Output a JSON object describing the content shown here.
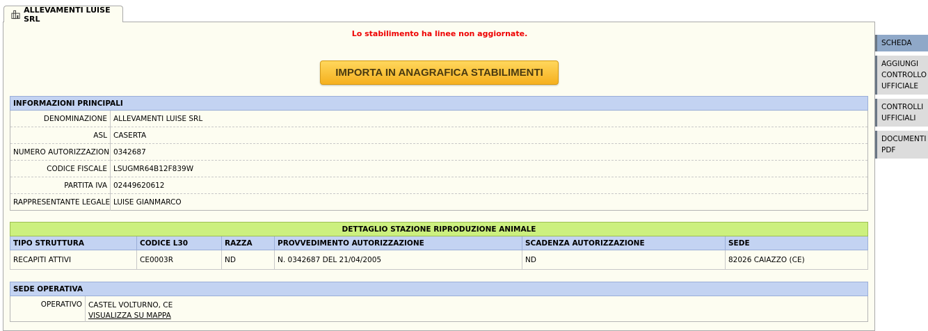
{
  "tab": {
    "title": "ALLEVAMENTI LUISE SRL"
  },
  "alert": "Lo stabilimento ha linee non aggiornate.",
  "import_button": "IMPORTA IN ANAGRAFICA STABILIMENTI",
  "info": {
    "header": "INFORMAZIONI PRINCIPALI",
    "rows": [
      {
        "label": "DENOMINAZIONE",
        "value": "ALLEVAMENTI LUISE SRL"
      },
      {
        "label": "ASL",
        "value": "CASERTA"
      },
      {
        "label": "NUMERO AUTORIZZAZIONE",
        "value": "0342687"
      },
      {
        "label": "CODICE FISCALE",
        "value": "LSUGMR64B12F839W"
      },
      {
        "label": "PARTITA IVA",
        "value": "02449620612"
      },
      {
        "label": "RAPPRESENTANTE LEGALE",
        "value": "LUISE GIANMARCO"
      }
    ]
  },
  "detail": {
    "header": "DETTAGLIO STAZIONE RIPRODUZIONE ANIMALE",
    "columns": [
      "TIPO STRUTTURA",
      "CODICE L30",
      "RAZZA",
      "PROVVEDIMENTO AUTORIZZAZIONE",
      "SCADENZA AUTORIZZAZIONE",
      "SEDE"
    ],
    "row": [
      "RECAPITI ATTIVI",
      "CE0003R",
      "ND",
      "N. 0342687 DEL 21/04/2005",
      "ND",
      "82026 CAIAZZO (CE)"
    ]
  },
  "sede": {
    "header": "SEDE OPERATIVA",
    "label": "OPERATIVO",
    "address": "CASTEL VOLTURNO, CE",
    "map_link": "VISUALIZZA SU MAPPA"
  },
  "sidebar": {
    "items": [
      {
        "label": "SCHEDA",
        "active": true
      },
      {
        "label": "AGGIUNGI CONTROLLO UFFICIALE",
        "active": false
      },
      {
        "label": "CONTROLLI UFFICIALI",
        "active": false
      },
      {
        "label": "DOCUMENTI PDF",
        "active": false
      }
    ]
  },
  "colors": {
    "header_blue": "#c3d3f2",
    "header_green": "#ccf07f",
    "alert_red": "#ee0000",
    "button_orange": "#f5b01e",
    "panel_bg": "#fdfdf1"
  }
}
